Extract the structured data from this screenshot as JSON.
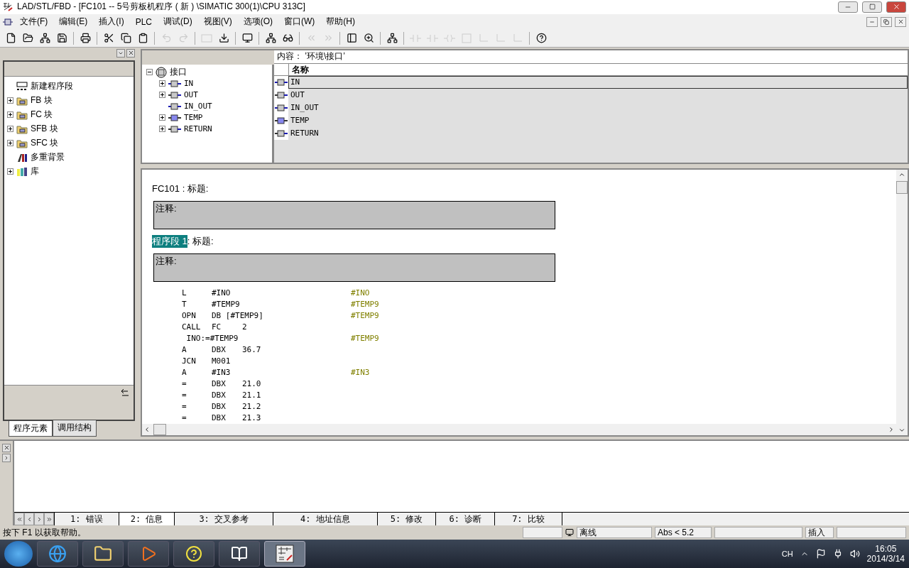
{
  "window": {
    "title": "LAD/STL/FBD  - [FC101 -- 5号剪板机程序 ( 新 ) \\SIMATIC 300(1)\\CPU 313C]"
  },
  "menu": [
    "文件(F)",
    "编辑(E)",
    "插入(I)",
    "PLC",
    "调试(D)",
    "视图(V)",
    "选项(O)",
    "窗口(W)",
    "帮助(H)"
  ],
  "toolbar": [
    {
      "kind": "new",
      "disabled": false
    },
    {
      "kind": "open",
      "disabled": false
    },
    {
      "kind": "network",
      "disabled": false
    },
    {
      "kind": "save",
      "disabled": false
    },
    {
      "kind": "sep"
    },
    {
      "kind": "print",
      "disabled": false
    },
    {
      "kind": "sep"
    },
    {
      "kind": "cut",
      "disabled": false
    },
    {
      "kind": "copy",
      "disabled": false
    },
    {
      "kind": "paste",
      "disabled": false
    },
    {
      "kind": "sep"
    },
    {
      "kind": "undo",
      "disabled": true
    },
    {
      "kind": "redo",
      "disabled": true
    },
    {
      "kind": "sep"
    },
    {
      "kind": "block",
      "disabled": true
    },
    {
      "kind": "download",
      "disabled": false
    },
    {
      "kind": "sep"
    },
    {
      "kind": "monitor",
      "disabled": false
    },
    {
      "kind": "sep"
    },
    {
      "kind": "network",
      "disabled": false
    },
    {
      "kind": "glasses",
      "disabled": false
    },
    {
      "kind": "sep"
    },
    {
      "kind": "prev",
      "disabled": true
    },
    {
      "kind": "next",
      "disabled": true
    },
    {
      "kind": "sep"
    },
    {
      "kind": "panel",
      "disabled": false
    },
    {
      "kind": "zoom",
      "disabled": false
    },
    {
      "kind": "sep"
    },
    {
      "kind": "network",
      "disabled": false
    },
    {
      "kind": "sep"
    },
    {
      "kind": "contact",
      "disabled": true
    },
    {
      "kind": "contact",
      "disabled": true
    },
    {
      "kind": "coil",
      "disabled": true
    },
    {
      "kind": "box",
      "disabled": true
    },
    {
      "kind": "branch",
      "disabled": true
    },
    {
      "kind": "branch",
      "disabled": true
    },
    {
      "kind": "branch",
      "disabled": true
    },
    {
      "kind": "sep"
    },
    {
      "kind": "help",
      "disabled": false
    }
  ],
  "sidebar": {
    "items": [
      {
        "label": "新建程序段",
        "kind": "network",
        "expandable": false
      },
      {
        "label": "FB 块",
        "kind": "folder",
        "expandable": true
      },
      {
        "label": "FC 块",
        "kind": "folder",
        "expandable": true
      },
      {
        "label": "SFB 块",
        "kind": "folder",
        "expandable": true
      },
      {
        "label": "SFC 块",
        "kind": "folder",
        "expandable": true
      },
      {
        "label": "多重背景",
        "kind": "books",
        "expandable": false
      },
      {
        "label": "库",
        "kind": "library",
        "expandable": true
      }
    ],
    "tabs": [
      {
        "label": "程序元素",
        "selected": true
      },
      {
        "label": "调用结构",
        "selected": false
      }
    ]
  },
  "interface": {
    "root": "接口",
    "nodes": [
      {
        "label": "IN",
        "kind": "in",
        "expandable": true
      },
      {
        "label": "OUT",
        "kind": "out",
        "expandable": true
      },
      {
        "label": "IN_OUT",
        "kind": "in",
        "expandable": false
      },
      {
        "label": "TEMP",
        "kind": "temp",
        "expandable": true
      },
      {
        "label": "RETURN",
        "kind": "out",
        "expandable": true
      }
    ],
    "content_label": "内容： ’环境\\接口’",
    "column": "名称",
    "rows": [
      {
        "name": "IN",
        "kind": "in",
        "selected": true
      },
      {
        "name": "OUT",
        "kind": "out",
        "selected": false
      },
      {
        "name": "IN_OUT",
        "kind": "in",
        "selected": false
      },
      {
        "name": "TEMP",
        "kind": "temp",
        "selected": false
      },
      {
        "name": "RETURN",
        "kind": "out",
        "selected": false
      }
    ]
  },
  "editor": {
    "block_title": "FC101 : 标题:",
    "block_comment": "注释:",
    "network": {
      "label": "程序段 1",
      "selected": true,
      "title": ": 标题:",
      "comment": "注释:"
    },
    "lines": [
      {
        "instr": "L",
        "operand": "#INO",
        "comment": "#INO"
      },
      {
        "instr": "T",
        "operand": "#TEMP9",
        "comment": "#TEMP9"
      },
      {
        "instr": "OPN",
        "operand": "DB [#TEMP9]",
        "comment": "#TEMP9"
      },
      {
        "instr": "CALL",
        "operand": "FC",
        "address": "2"
      },
      {
        "instr": " INO:=#TEMP9",
        "comment": "#TEMP9"
      },
      {
        "instr": "A",
        "operand": "DBX",
        "address": "36.7"
      },
      {
        "instr": "JCN",
        "operand": "M001"
      },
      {
        "instr": "A",
        "operand": "#IN3",
        "comment": "#IN3"
      },
      {
        "instr": "=",
        "operand": "DBX",
        "address": "21.0"
      },
      {
        "instr": "=",
        "operand": "DBX",
        "address": "21.1"
      },
      {
        "instr": "=",
        "operand": "DBX",
        "address": "21.2"
      },
      {
        "instr": "=",
        "operand": "DBX",
        "address": "21.3"
      }
    ]
  },
  "output": {
    "tabs": [
      {
        "label": "1: 错误",
        "selected": false
      },
      {
        "label": "2: 信息",
        "selected": true
      },
      {
        "label": "3: 交叉参考",
        "selected": false
      },
      {
        "label": "4: 地址信息",
        "selected": false
      },
      {
        "label": "5: 修改",
        "selected": false
      },
      {
        "label": "6: 诊断",
        "selected": false
      },
      {
        "label": "7: 比较",
        "selected": false
      }
    ]
  },
  "status_bar": {
    "help": "按下 F1 以获取帮助。",
    "mode": "离线",
    "abs": "Abs < 5.2",
    "insert": "插入"
  },
  "taskbar": {
    "apps": [
      {
        "kind": "ie",
        "active": false
      },
      {
        "kind": "folder",
        "active": false
      },
      {
        "kind": "media",
        "active": false
      },
      {
        "kind": "help",
        "active": false
      },
      {
        "kind": "simatic",
        "active": false
      },
      {
        "kind": "ladder",
        "active": true
      }
    ],
    "language": "CH",
    "time": "16:05",
    "date": "2014/3/14"
  }
}
